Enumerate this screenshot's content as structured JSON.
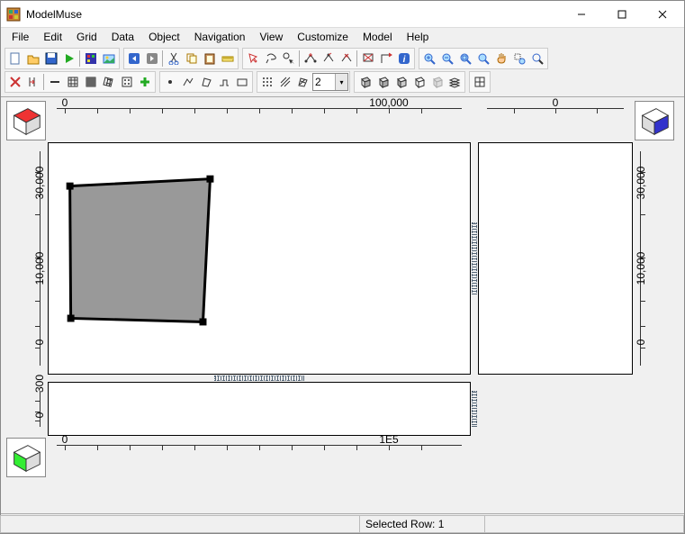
{
  "window": {
    "title": "ModelMuse"
  },
  "menu": {
    "items": [
      "File",
      "Edit",
      "Grid",
      "Data",
      "Object",
      "Navigation",
      "View",
      "Customize",
      "Model",
      "Help"
    ]
  },
  "spin": {
    "value": "2"
  },
  "rulers": {
    "top_left": {
      "labels": [
        "0",
        "100,000"
      ]
    },
    "top_right": {
      "labels": [
        "0"
      ]
    },
    "left": {
      "labels": [
        "0",
        "10,000",
        "30,000"
      ]
    },
    "right": {
      "labels": [
        "0",
        "10,000",
        "30,000"
      ]
    },
    "bottom": {
      "labels": [
        "0",
        "1E5"
      ]
    },
    "side_bottom": {
      "labels": [
        "0",
        "300"
      ]
    }
  },
  "status": {
    "selected_row": "Selected Row: 1"
  }
}
